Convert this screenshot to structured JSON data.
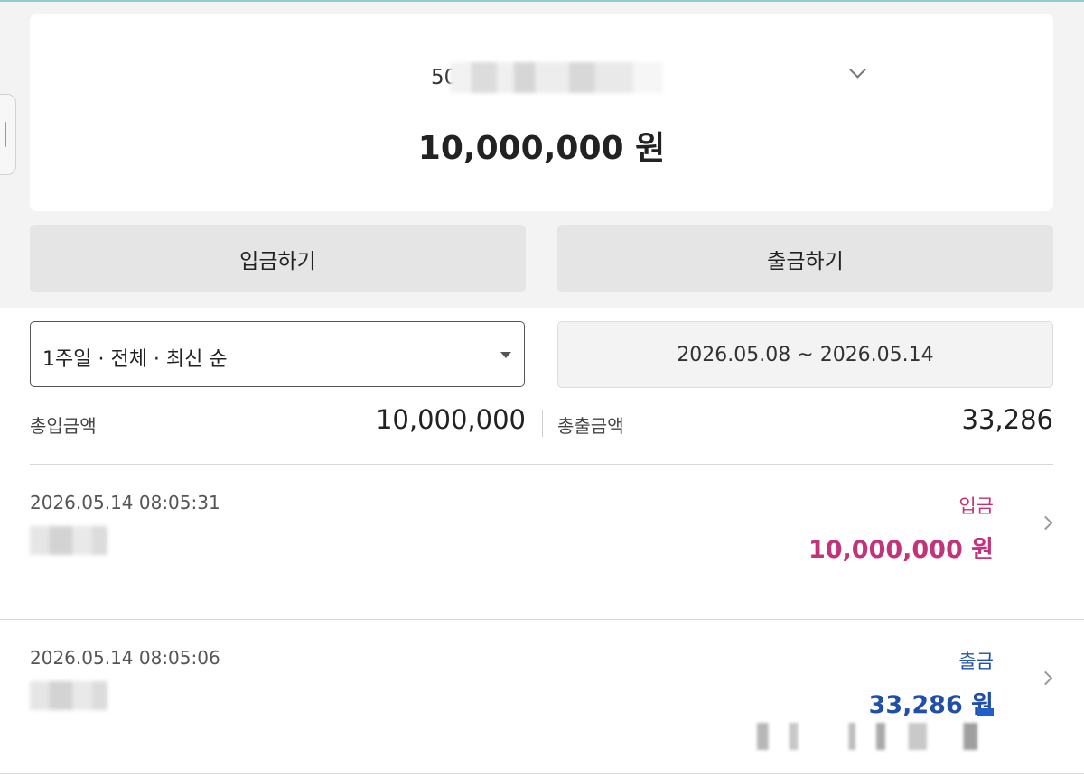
{
  "account": {
    "number_visible": "50",
    "balance": "10,000,000 원"
  },
  "actions": {
    "deposit_label": "입금하기",
    "withdraw_label": "출금하기"
  },
  "filter": {
    "selected": "1주일 · 전체 · 최신 순",
    "date_range": "2026.05.08 ~ 2026.05.14"
  },
  "summary": {
    "total_deposit_label": "총입금액",
    "total_deposit_value": "10,000,000",
    "total_withdraw_label": "총출금액",
    "total_withdraw_value": "33,286"
  },
  "transactions": [
    {
      "datetime": "2026.05.14 08:05:31",
      "type": "입금",
      "amount": "10,000,000 원",
      "color": "#c2337a"
    },
    {
      "datetime": "2026.05.14 08:05:06",
      "type": "출금",
      "amount": "33,286 원",
      "color": "#1f4fa8"
    }
  ],
  "icons": {
    "account_dropdown": "chevron-down-icon",
    "filter_dropdown": "caret-down-icon",
    "row_detail": "chevron-right-icon"
  }
}
